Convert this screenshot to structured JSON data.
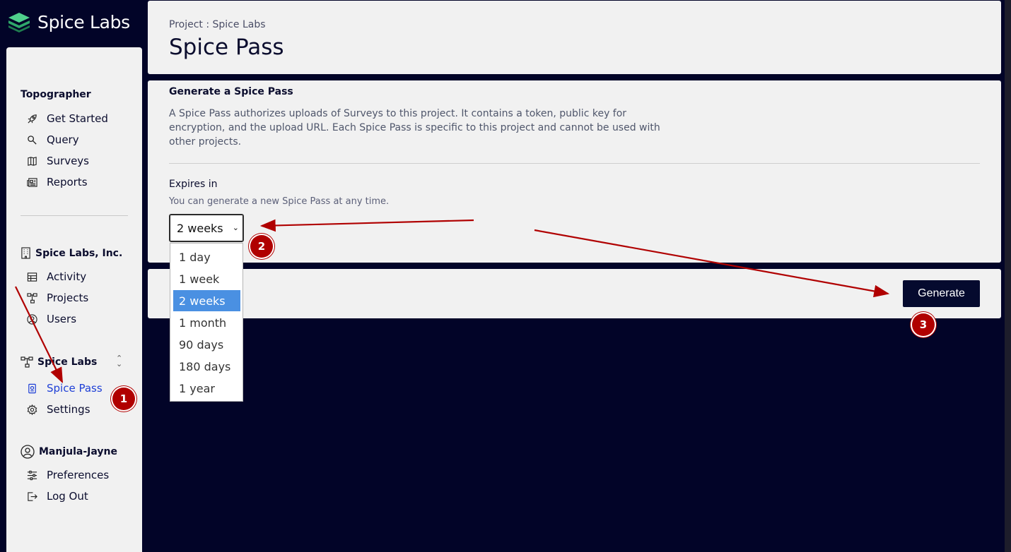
{
  "brand": {
    "name": "Spice Labs",
    "logo_icon": "layers-logo-icon",
    "accent": "#3fbf7f"
  },
  "sidebar": {
    "topographer": {
      "title": "Topographer",
      "items": [
        {
          "label": "Get Started",
          "icon": "rocket-icon"
        },
        {
          "label": "Query",
          "icon": "search-icon"
        },
        {
          "label": "Surveys",
          "icon": "map-icon"
        },
        {
          "label": "Reports",
          "icon": "newspaper-icon"
        }
      ]
    },
    "org": {
      "title": "Spice Labs, Inc.",
      "items": [
        {
          "label": "Activity",
          "icon": "table-icon"
        },
        {
          "label": "Projects",
          "icon": "hierarchy-icon"
        },
        {
          "label": "Users",
          "icon": "user-circle-icon"
        }
      ]
    },
    "project": {
      "title": "Spice Labs",
      "items": [
        {
          "label": "Spice Pass",
          "icon": "badge-icon",
          "active": true
        },
        {
          "label": "Settings",
          "icon": "gear-icon"
        }
      ]
    },
    "user": {
      "title": "Manjula-Jayne",
      "items": [
        {
          "label": "Preferences",
          "icon": "sliders-icon"
        },
        {
          "label": "Log Out",
          "icon": "logout-icon"
        }
      ]
    }
  },
  "header": {
    "breadcrumb": "Project : Spice Labs",
    "title": "Spice Pass"
  },
  "card": {
    "title": "Generate a Spice Pass",
    "description": "A Spice Pass authorizes uploads of Surveys to this project. It contains a token, public key for encryption, and the upload URL. Each Spice Pass is specific to this project and cannot be used with other projects.",
    "expires_label": "Expires in",
    "expires_help": "You can generate a new Spice Pass at any time.",
    "select_value": "2 weeks",
    "options": [
      "1 day",
      "1 week",
      "2 weeks",
      "1 month",
      "90 days",
      "180 days",
      "1 year"
    ],
    "selected_index": 2
  },
  "actions": {
    "generate_label": "Generate"
  },
  "annotations": {
    "badges": [
      "1",
      "2",
      "3"
    ],
    "color": "#b00000"
  }
}
